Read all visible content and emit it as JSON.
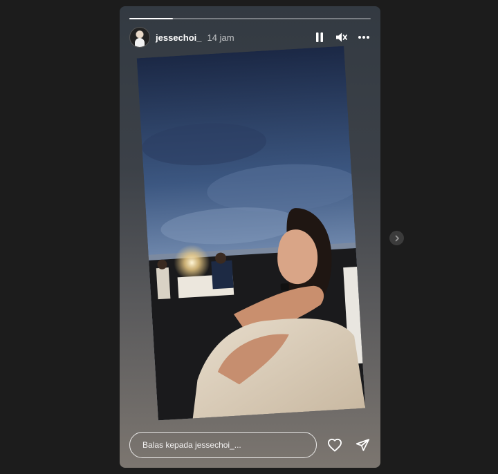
{
  "story": {
    "progress_fraction": 0.18,
    "username": "jessechoi_",
    "timestamp": "14 jam",
    "reply_placeholder": "Balas kepada jessechoi_..."
  },
  "icons": {
    "pause": "pause-icon",
    "mute": "speaker-muted-icon",
    "more": "more-options-icon",
    "like": "heart-icon",
    "share": "send-icon",
    "next": "chevron-right-icon"
  },
  "colors": {
    "background": "#1c1c1c",
    "text": "#ffffff",
    "card_top": "#333a42",
    "card_bottom": "#7c7670"
  }
}
